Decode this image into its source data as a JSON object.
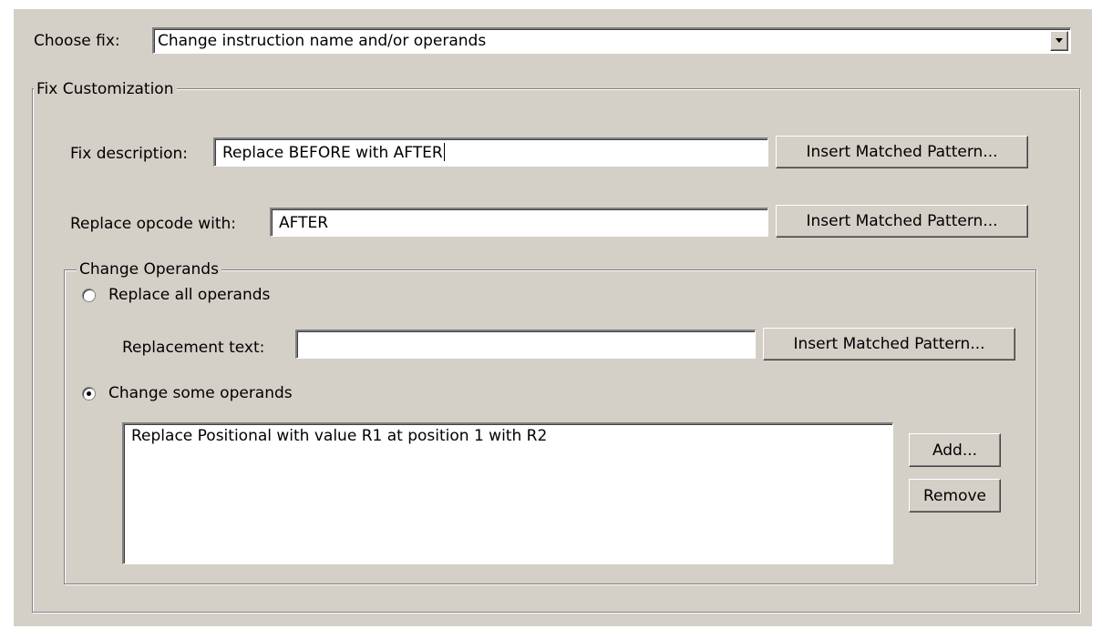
{
  "choose_fix": {
    "label": "Choose fix:",
    "selected": "Change instruction name and/or operands"
  },
  "fix_customization": {
    "legend": "Fix Customization",
    "description_label": "Fix description:",
    "description_value": "Replace BEFORE with AFTER",
    "opcode_label": "Replace opcode with:",
    "opcode_value": "AFTER",
    "insert_pattern_label": "Insert Matched Pattern..."
  },
  "change_operands": {
    "legend": "Change Operands",
    "replace_all_label": "Replace all operands",
    "replace_all_selected": false,
    "replacement_text_label": "Replacement text:",
    "replacement_text_value": "",
    "change_some_label": "Change some operands",
    "change_some_selected": true,
    "operands_list": [
      "Replace Positional with value R1 at position 1 with R2"
    ],
    "add_label": "Add...",
    "remove_label": "Remove"
  }
}
